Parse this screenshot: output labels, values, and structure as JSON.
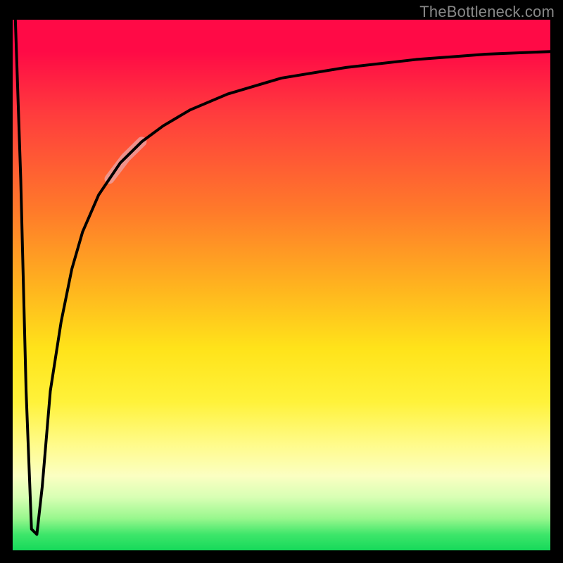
{
  "watermark": "TheBottleneck.com",
  "chart_data": {
    "type": "line",
    "title": "",
    "xlabel": "",
    "ylabel": "",
    "xlim": [
      0,
      100
    ],
    "ylim": [
      0,
      100
    ],
    "grid": false,
    "legend": false,
    "background": {
      "type": "vertical-gradient",
      "stops": [
        {
          "pos": 0,
          "color": "#ff0a46"
        },
        {
          "pos": 0.18,
          "color": "#ff3d3d"
        },
        {
          "pos": 0.36,
          "color": "#ff7a2a"
        },
        {
          "pos": 0.5,
          "color": "#ffb21f"
        },
        {
          "pos": 0.62,
          "color": "#ffe31a"
        },
        {
          "pos": 0.8,
          "color": "#fffb8a"
        },
        {
          "pos": 0.9,
          "color": "#d8ffb4"
        },
        {
          "pos": 1.0,
          "color": "#16d95a"
        }
      ]
    },
    "series": [
      {
        "name": "bottleneck-curve",
        "color": "#000000",
        "x": [
          0.5,
          1.5,
          2.5,
          3.5,
          4.5,
          5.5,
          7,
          9,
          11,
          13,
          16,
          20,
          24,
          28,
          33,
          40,
          50,
          62,
          75,
          88,
          100
        ],
        "values": [
          100,
          70,
          30,
          4,
          3,
          12,
          30,
          43,
          53,
          60,
          67,
          73,
          77,
          80,
          83,
          86,
          89,
          91,
          92.5,
          93.5,
          94
        ]
      }
    ],
    "highlight": {
      "name": "highlight-segment",
      "color": "#e9a5aa",
      "opacity": 0.75,
      "x": [
        18,
        19.5,
        21,
        22.5,
        24
      ],
      "values": [
        70,
        72,
        74,
        75.5,
        77
      ]
    }
  }
}
